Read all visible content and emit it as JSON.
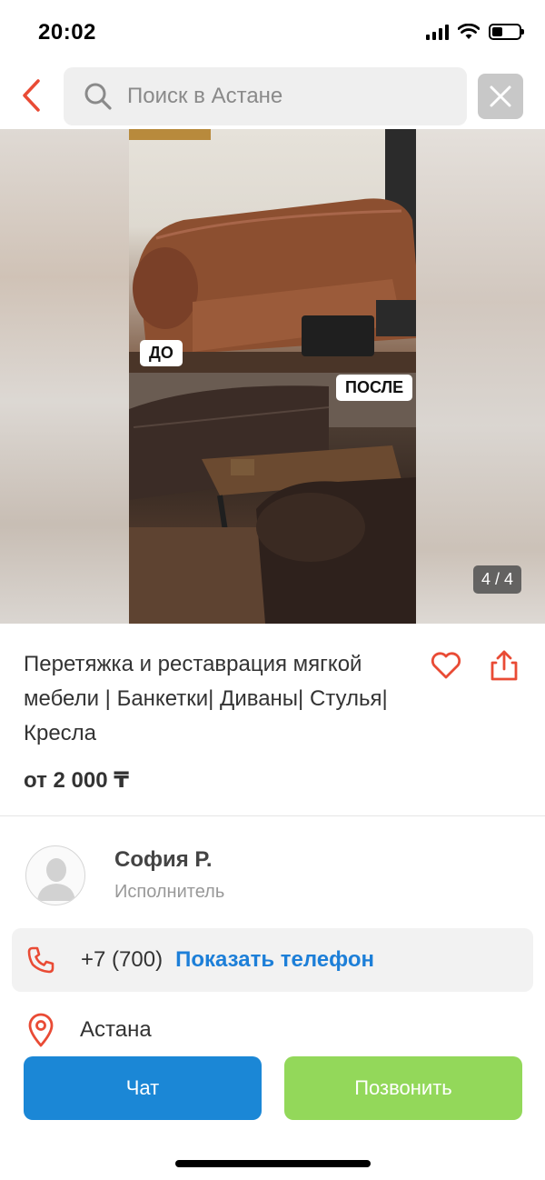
{
  "status_bar": {
    "time": "20:02",
    "icons": [
      "signal-icon",
      "wifi-icon",
      "battery-icon"
    ]
  },
  "search": {
    "placeholder": "Поиск в Астане",
    "back_icon": "chevron-left-icon",
    "search_icon": "search-icon",
    "clear_icon": "close-icon"
  },
  "gallery": {
    "label_before": "ДО",
    "label_after": "ПОСЛЕ",
    "counter": "4 / 4"
  },
  "listing": {
    "title": "Перетяжка и реставрация мягкой мебели | Банкетки| Диваны| Стулья| Кресла",
    "price": "от 2 000 ₸",
    "favorite_icon": "heart-icon",
    "share_icon": "share-icon"
  },
  "seller": {
    "name": "София Р.",
    "role": "Исполнитель"
  },
  "phone": {
    "number": "+7 (700)",
    "show_label": "Показать телефон"
  },
  "location": {
    "city": "Астана"
  },
  "actions": {
    "chat_label": "Чат",
    "call_label": "Позвонить"
  },
  "colors": {
    "accent_red": "#e94b35",
    "link_blue": "#1d7fd8",
    "chat_button": "#1b87d6",
    "call_button": "#93d85a"
  }
}
